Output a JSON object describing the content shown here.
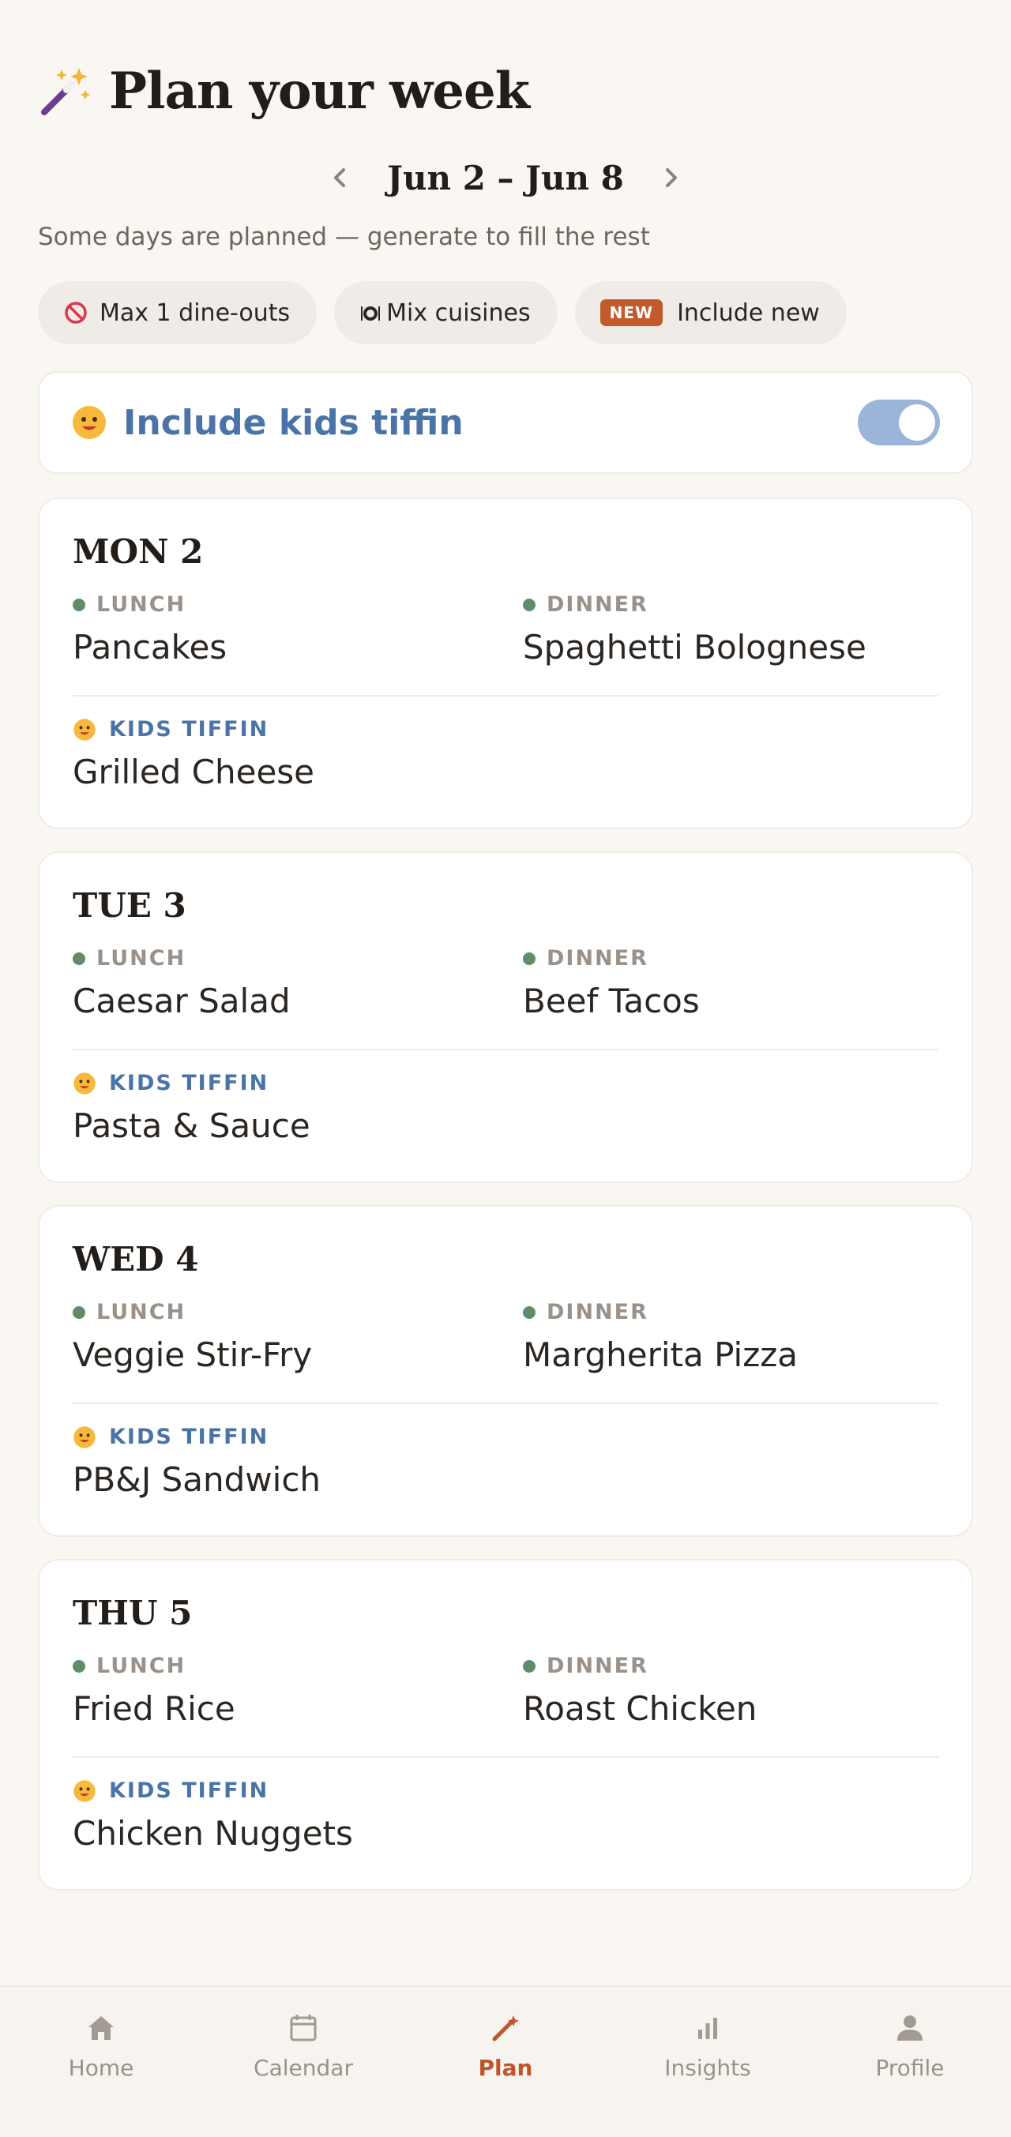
{
  "header": {
    "title": "Plan your week",
    "icon": "magic-wand-icon"
  },
  "week": {
    "label": "Jun 2 – Jun 8",
    "prev_icon": "chevron-left-icon",
    "next_icon": "chevron-right-icon"
  },
  "subtitle": "Some days are planned — generate to fill the rest",
  "chips": [
    {
      "icon": "no-entry-icon",
      "label": "Max 1 dine-outs"
    },
    {
      "icon": "plate-icon",
      "label": "Mix cuisines"
    },
    {
      "badge": "NEW",
      "label": "Include new"
    }
  ],
  "kids_toggle": {
    "label": "Include kids tiffin",
    "enabled": true,
    "icon": "kid-face-icon"
  },
  "labels": {
    "lunch": "LUNCH",
    "dinner": "DINNER",
    "tiffin": "KIDS TIFFIN"
  },
  "days": [
    {
      "title": "MON 2",
      "lunch": "Pancakes",
      "dinner": "Spaghetti Bolognese",
      "tiffin": "Grilled Cheese"
    },
    {
      "title": "TUE 3",
      "lunch": "Caesar Salad",
      "dinner": "Beef Tacos",
      "tiffin": "Pasta & Sauce"
    },
    {
      "title": "WED 4",
      "lunch": "Veggie Stir-Fry",
      "dinner": "Margherita Pizza",
      "tiffin": "PB&J Sandwich"
    },
    {
      "title": "THU 5",
      "lunch": "Fried Rice",
      "dinner": "Roast Chicken",
      "tiffin": "Chicken Nuggets"
    }
  ],
  "nav": [
    {
      "label": "Home",
      "icon": "home-icon",
      "active": false
    },
    {
      "label": "Calendar",
      "icon": "calendar-icon",
      "active": false
    },
    {
      "label": "Plan",
      "icon": "pen-icon",
      "active": true
    },
    {
      "label": "Insights",
      "icon": "bar-chart-icon",
      "active": false
    },
    {
      "label": "Profile",
      "icon": "person-icon",
      "active": false
    }
  ],
  "colors": {
    "accent": "#c1542a",
    "kids_blue": "#4a73a8",
    "meal_dot": "#5f8d6c",
    "toggle_on": "#9bb5d8",
    "background": "#faf7f3"
  }
}
